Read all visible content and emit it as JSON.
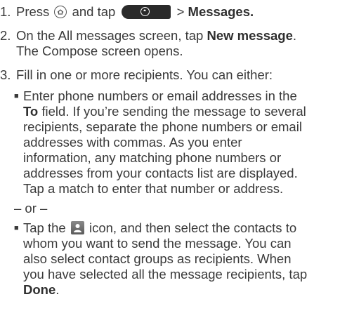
{
  "steps": [
    {
      "num": "1.",
      "pre": "Press",
      "mid": "and tap",
      "post_sep": ">",
      "post_bold": "Messages."
    },
    {
      "num": "2.",
      "line1_pre": "On the All messages screen, tap",
      "line1_bold": "New message",
      "line1_post": ".",
      "line2": "The Compose screen opens."
    },
    {
      "num": "3.",
      "intro": "Fill in one or more recipients. You can either:",
      "bullet1": {
        "line1": "Enter phone numbers or email addresses in the",
        "line2_bold": "To",
        "line2_rest": "field. If you’re sending the message to several",
        "line3": "recipients, separate the phone numbers or email",
        "line4": "addresses with commas. As you enter",
        "line5": "information, any matching phone numbers or",
        "line6": "addresses from your contacts list are displayed.",
        "line7": "Tap a match to enter that number or address."
      },
      "or_text": "– or –",
      "bullet2": {
        "line1_pre": "Tap the",
        "line1_post": "icon, and then select the contacts to",
        "line2": "whom you want to send the message. You can",
        "line3": "also select contact groups as recipients. When",
        "line4": "you have selected all the message recipients, tap",
        "line5_bold": "Done",
        "line5_post": "."
      }
    }
  ],
  "icons": [
    "home-icon",
    "all-apps-button-icon",
    "contacts-icon"
  ]
}
